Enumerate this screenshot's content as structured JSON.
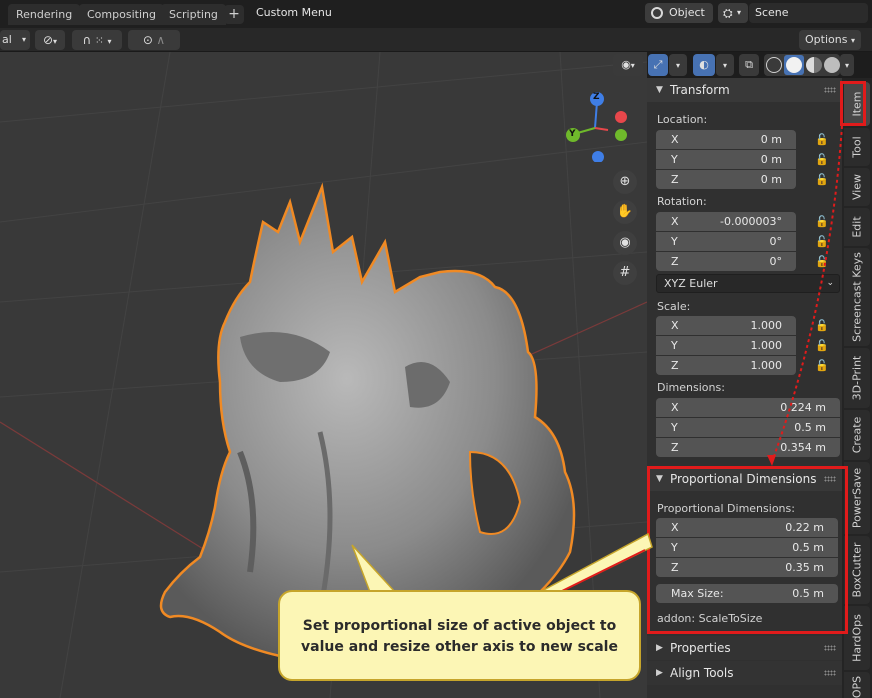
{
  "header": {
    "tabs": [
      "Rendering",
      "Compositing",
      "Scripting"
    ],
    "add_tab": "+",
    "menu_label": "Custom Menu",
    "mode": "Object",
    "scene": "Scene"
  },
  "toolbar": {
    "left_label": "al",
    "options": "Options"
  },
  "npanel": {
    "transform": {
      "title": "Transform",
      "location_label": "Location:",
      "location": [
        {
          "axis": "X",
          "value": "0 m"
        },
        {
          "axis": "Y",
          "value": "0 m"
        },
        {
          "axis": "Z",
          "value": "0 m"
        }
      ],
      "rotation_label": "Rotation:",
      "rotation": [
        {
          "axis": "X",
          "value": "-0.000003°"
        },
        {
          "axis": "Y",
          "value": "0°"
        },
        {
          "axis": "Z",
          "value": "0°"
        }
      ],
      "rotation_mode": "XYZ Euler",
      "scale_label": "Scale:",
      "scale": [
        {
          "axis": "X",
          "value": "1.000"
        },
        {
          "axis": "Y",
          "value": "1.000"
        },
        {
          "axis": "Z",
          "value": "1.000"
        }
      ],
      "dimensions_label": "Dimensions:",
      "dimensions": [
        {
          "axis": "X",
          "value": "0.224 m"
        },
        {
          "axis": "Y",
          "value": "0.5 m"
        },
        {
          "axis": "Z",
          "value": "0.354 m"
        }
      ]
    },
    "proportional": {
      "title": "Proportional Dimensions",
      "label": "Proportional Dimensions:",
      "dims": [
        {
          "axis": "X",
          "value": "0.22 m"
        },
        {
          "axis": "Y",
          "value": "0.5 m"
        },
        {
          "axis": "Z",
          "value": "0.35 m"
        }
      ],
      "max_size_label": "Max Size:",
      "max_size_value": "0.5 m",
      "addon": "addon: ScaleToSize"
    },
    "properties_title": "Properties",
    "align_tools_title": "Align Tools"
  },
  "vtabs": [
    "Item",
    "Tool",
    "View",
    "Edit",
    "Screencast Keys",
    "3D-Print",
    "Create",
    "PowerSave",
    "BoxCutter",
    "HardOps",
    "OPS"
  ],
  "gizmo": {
    "x": "X",
    "y": "Y",
    "z": "Z"
  },
  "callout": {
    "line1": "Set proportional size of active object to",
    "line2": "value and resize other axis to new scale"
  },
  "colors": {
    "annotation": "#e11b1b",
    "callout_bg": "#fcf6b5",
    "selection_outline": "#f08a24",
    "gizmo_x": "#e8474b",
    "gizmo_y": "#6fb92b",
    "gizmo_z": "#3f7ee6"
  }
}
